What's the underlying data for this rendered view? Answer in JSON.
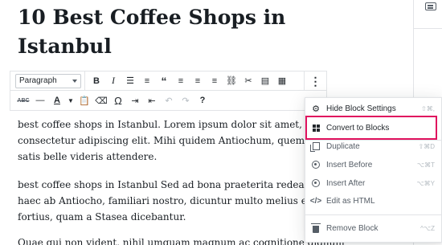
{
  "post": {
    "title_lines": [
      "10 Best Coffee Shops in",
      "Istanbul"
    ]
  },
  "toolbar": {
    "block_type": "Paragraph",
    "row1_icons": [
      "bold-icon",
      "italic-icon",
      "unordered-list-icon",
      "ordered-list-icon",
      "blockquote-icon",
      "align-left-icon",
      "align-center-icon",
      "align-right-icon",
      "link-icon",
      "unlink-icon",
      "read-more-icon",
      "toolbar-toggle-icon",
      "more-options-icon"
    ],
    "row2_icons": [
      "strikethrough-icon",
      "horizontal-line-icon",
      "text-color-icon",
      "paste-text-icon",
      "clear-formatting-icon",
      "special-character-icon",
      "indent-icon",
      "outdent-icon",
      "undo-icon",
      "redo-icon",
      "help-icon"
    ],
    "strikethrough_label": "ABC",
    "text_color_label": "A",
    "omega_label": "Ω"
  },
  "content": {
    "p1": [
      "best coffee shops in Istanbul. Lorem ipsum dolor sit amet,",
      "consectetur adipiscing elit. Mihi quidem Antiochum, quem audis,",
      "satis belle videris attendere."
    ],
    "p2": [
      "best coffee shops in Istanbul Sed ad bona praeterita redeamus. Sed",
      "haec ab Antiocho, familiari nostro, dicuntur multo melius et",
      "fortius, quam a Stasea dicebantur."
    ],
    "p3": [
      "Quae qui non vident, nihil umquam magnum ac cognitione dignum"
    ]
  },
  "menu": {
    "items": [
      {
        "label": "Hide Block Settings",
        "shortcut": "⇧⌘,",
        "icon": "gear-icon"
      },
      {
        "label": "Convert to Blocks",
        "shortcut": "",
        "icon": "blocks-grid-icon"
      },
      {
        "label": "Duplicate",
        "shortcut": "⇧⌘D",
        "icon": "duplicate-icon"
      },
      {
        "label": "Insert Before",
        "shortcut": "⌥⌘T",
        "icon": "insert-before-icon"
      },
      {
        "label": "Insert After",
        "shortcut": "⌥⌘Y",
        "icon": "insert-after-icon"
      },
      {
        "label": "Edit as HTML",
        "shortcut": "",
        "icon": "html-icon"
      },
      {
        "label": "Remove Block",
        "shortcut": "^⌥Z",
        "icon": "trash-icon"
      }
    ]
  },
  "colors": {
    "highlight": "#e0125e",
    "text": "#191e23",
    "icon_grey": "#555d66",
    "border": "#e2e4e7"
  }
}
